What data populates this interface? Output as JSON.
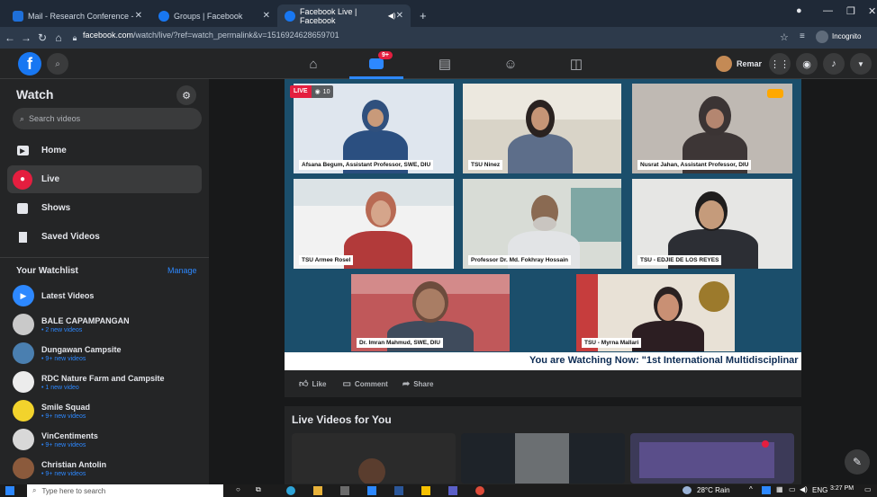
{
  "browser": {
    "tabs": [
      {
        "title": "Mail - Research Conference - Ou",
        "active": false
      },
      {
        "title": "Groups | Facebook",
        "active": false
      },
      {
        "title": "Facebook Live | Facebook",
        "active": true
      }
    ],
    "new_tab": "+",
    "url_host": "facebook.com",
    "url_path": "/watch/live/?ref=watch_permalink&v=1516924628659701",
    "incognito_label": "Incognito"
  },
  "header": {
    "notifications_badge": "9+",
    "profile_name": "Remar"
  },
  "sidebar": {
    "title": "Watch",
    "search_placeholder": "Search videos",
    "items": [
      {
        "label": "Home",
        "icon": "play-icon",
        "active": false
      },
      {
        "label": "Live",
        "icon": "live-camera-icon",
        "active": true
      },
      {
        "label": "Shows",
        "icon": "shows-icon",
        "active": false
      },
      {
        "label": "Saved Videos",
        "icon": "bookmark-icon",
        "active": false
      }
    ],
    "watchlist_title": "Your Watchlist",
    "manage_label": "Manage",
    "watchlist": [
      {
        "name": "Latest Videos",
        "sub": ""
      },
      {
        "name": "BALE CAPAMPANGAN",
        "sub": "• 2 new videos"
      },
      {
        "name": "Dungawan Campsite",
        "sub": "• 9+ new videos"
      },
      {
        "name": "RDC Nature Farm and Campsite",
        "sub": "• 1 new video"
      },
      {
        "name": "Smile Squad",
        "sub": "• 9+ new videos"
      },
      {
        "name": "VinCentiments",
        "sub": "• 9+ new videos"
      },
      {
        "name": "Christian Antolin",
        "sub": "• 9+ new videos"
      }
    ]
  },
  "video": {
    "live_label": "LIVE",
    "viewers": "10",
    "participants": [
      "Afsana Begum, Assistant Professor, SWE, DIU",
      "TSU Ninez",
      "Nusrat Jahan, Assistant Professor, DIU",
      "TSU Armee Rosel",
      "Professor Dr. Md. Fokhray Hossain",
      "TSU - EDJIE DE LOS REYES",
      "Dr. Imran Mahmud, SWE, DIU",
      "TSU - Myrna Mallari"
    ],
    "ticker": "You are Watching Now: \"1st International Multidisciplinar"
  },
  "actions": {
    "like": "Like",
    "comment": "Comment",
    "share": "Share"
  },
  "live_for_you": {
    "title": "Live Videos for You"
  },
  "taskbar": {
    "search_placeholder": "Type here to search",
    "weather": "28°C  Rain",
    "lang": "ENG",
    "time": "3:27 PM"
  },
  "colors": {
    "accent": "#2d88ff",
    "live_red": "#e41e3f"
  }
}
